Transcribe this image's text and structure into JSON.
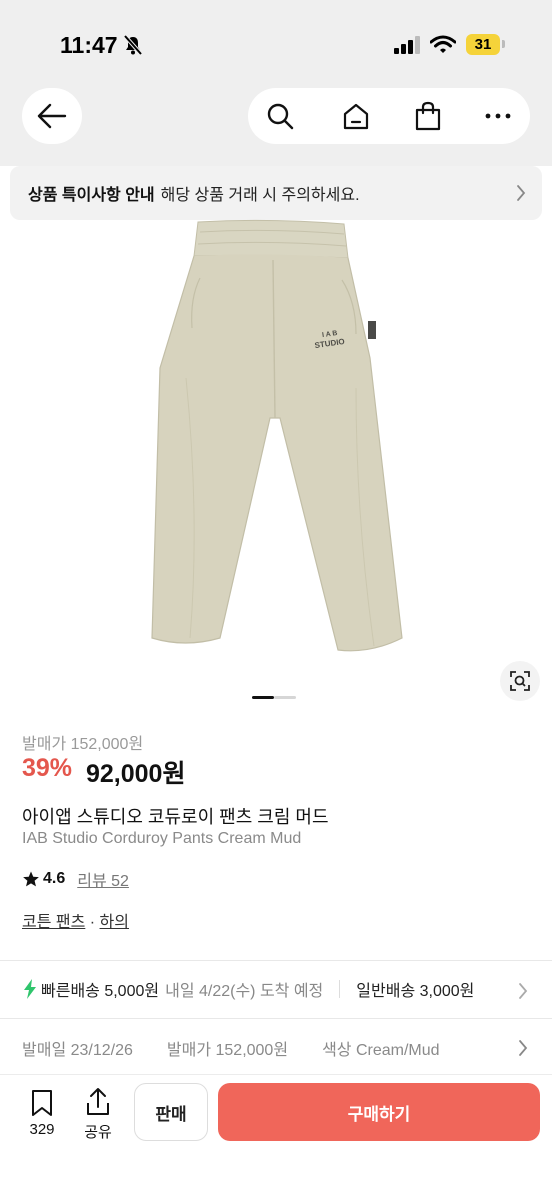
{
  "status_bar": {
    "time": "11:47",
    "battery": "31"
  },
  "nav": {
    "back_icon": "arrow-left-icon",
    "search_icon": "search-icon",
    "home_icon": "home-icon",
    "bag_icon": "shopping-bag-icon",
    "more_icon": "more-icon"
  },
  "notice": {
    "title": "상품 특이사항 안내",
    "text": "해당 상품 거래 시 주의하세요."
  },
  "product": {
    "image_logo_line1": "I A B",
    "image_logo_line2": "STUDIO",
    "original_price": "발매가 152,000원",
    "discount": "39%",
    "price": "92,000원",
    "title_ko": "아이앱 스튜디오 코듀로이 팬츠 크림 머드",
    "title_en": "IAB Studio Corduroy Pants Cream Mud",
    "rating": "4.6",
    "reviews": "리뷰 52",
    "category": "코튼 팬츠",
    "category_sep": " · ",
    "subcategory": "하의",
    "carousel_active_index": 1,
    "carousel_total": 2
  },
  "shipping": {
    "fast_label": "빠른배송 5,000원",
    "fast_date": "내일 4/22(수) 도착 예정",
    "normal_label": "일반배송 3,000원"
  },
  "meta": {
    "release_date": "발매일 23/12/26",
    "release_price": "발매가 152,000원",
    "color": "색상 Cream/Mud"
  },
  "bottom": {
    "wish_count": "329",
    "share_label": "공유",
    "sell_label": "판매",
    "buy_label": "구매하기"
  },
  "colors": {
    "accent": "#f0665a",
    "discount": "#e4574d",
    "fast_ship": "#2fc56c",
    "pants": "#d7d3be"
  }
}
